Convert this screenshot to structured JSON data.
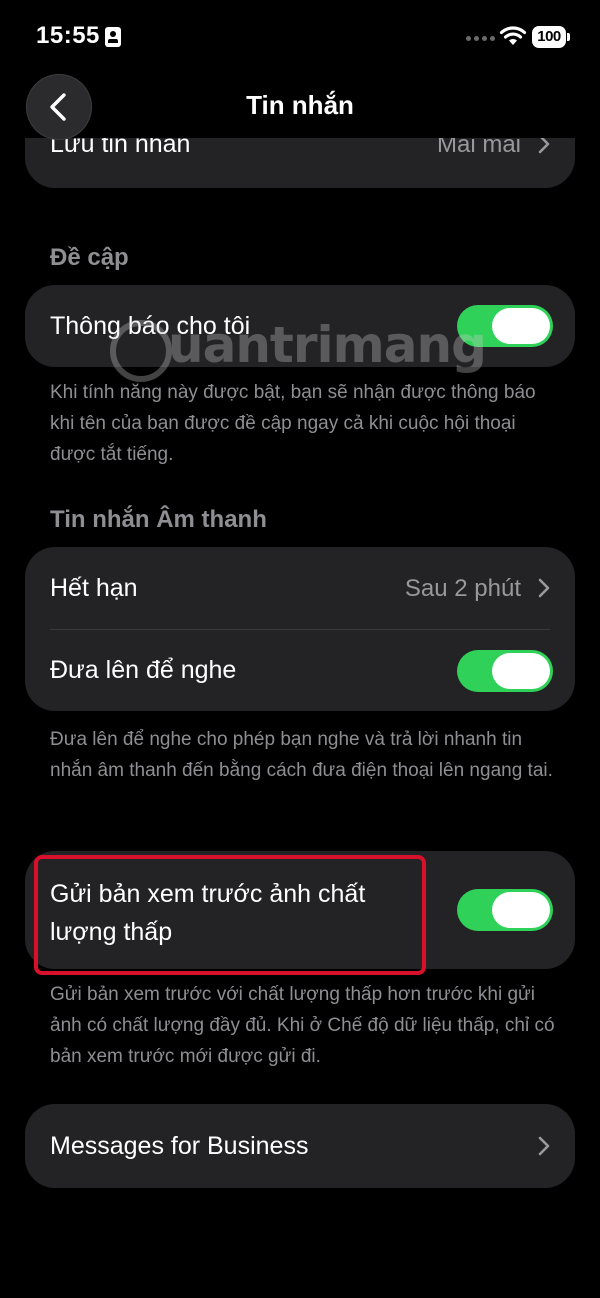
{
  "status_bar": {
    "time": "15:55",
    "battery": "100"
  },
  "nav": {
    "title": "Tin nhắn"
  },
  "retention_card": {
    "label": "Lưu tin nhắn",
    "value": "Mãi mãi"
  },
  "mentions": {
    "header": "Đề cập",
    "notify_label": "Thông báo cho tôi",
    "notify_on": true,
    "footnote": "Khi tính năng này được bật, bạn sẽ nhận được thông báo khi tên của bạn được đề cập ngay cả khi cuộc hội thoại được tắt tiếng."
  },
  "audio_messages": {
    "header": "Tin nhắn Âm thanh",
    "expire_label": "Hết hạn",
    "expire_value": "Sau 2 phút",
    "raise_label": "Đưa lên để nghe",
    "raise_on": true,
    "footnote": "Đưa lên để nghe cho phép bạn nghe và trả lời nhanh tin nhắn âm thanh đến bằng cách đưa điện thoại lên ngang tai."
  },
  "low_quality": {
    "label": "Gửi bản xem trước ảnh chất lượng thấp",
    "on": true,
    "footnote": "Gửi bản xem trước với chất lượng thấp hơn trước khi gửi ảnh có chất lượng đầy đủ. Khi ở Chế độ dữ liệu thấp, chỉ có bản xem trước mới được gửi đi."
  },
  "business": {
    "label": "Messages for Business"
  },
  "watermark": {
    "text": "uantrimang"
  },
  "colors": {
    "toggle_on": "#30d158",
    "card_bg": "#232325",
    "highlight": "#d7102b"
  },
  "icons": [
    "back-chevron-icon",
    "chevron-right-icon",
    "wifi-icon",
    "battery-icon",
    "contact-card-icon"
  ]
}
